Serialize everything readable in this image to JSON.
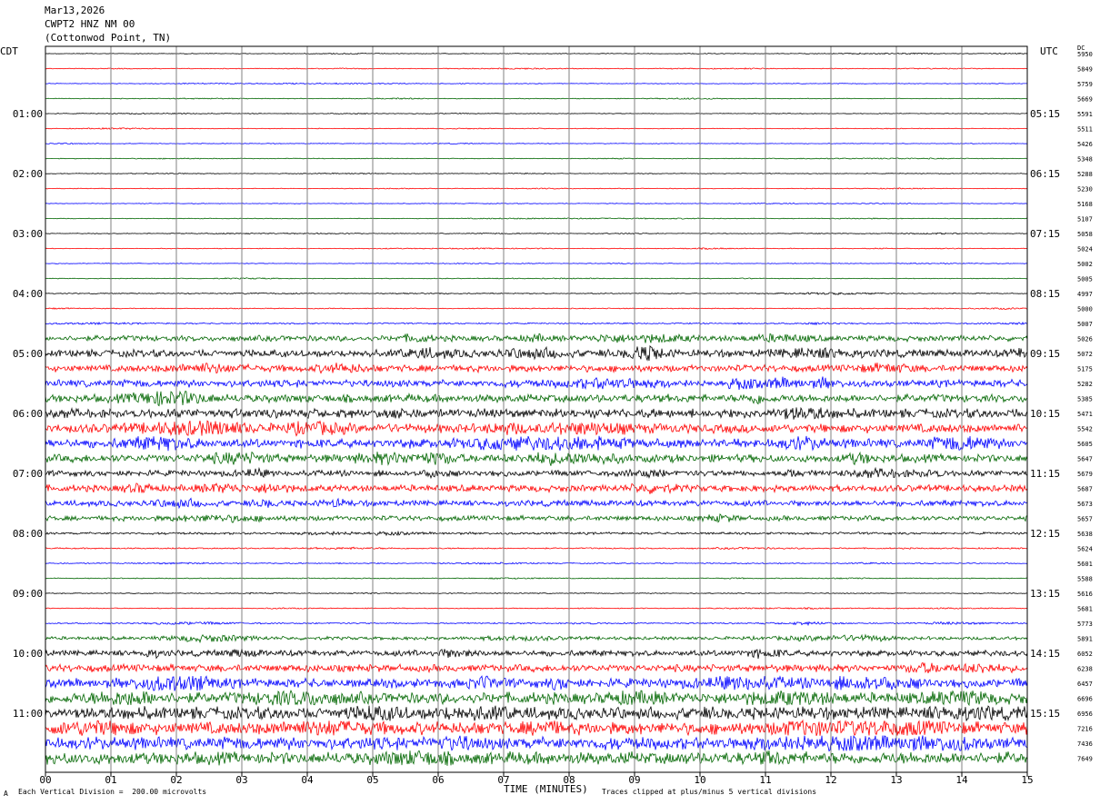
{
  "header": {
    "date": "Mar13,2026",
    "station": "CWPT2 HNZ NM 00",
    "location": "(Cottonwod Point, TN)"
  },
  "left_zone": "CDT",
  "right_zone": "UTC",
  "dc_label": "DC",
  "footer": {
    "scale_note": "Each Vertical Division =  200.00 microvolts",
    "clip_note": "Traces clipped at plus/minus 5 vertical divisions",
    "x_title": "TIME (MINUTES)",
    "mark": "A"
  },
  "chart_data": {
    "type": "line",
    "title": "",
    "xlabel": "TIME (MINUTES)",
    "x_ticks": [
      "00",
      "01",
      "02",
      "03",
      "04",
      "05",
      "06",
      "07",
      "08",
      "09",
      "10",
      "11",
      "12",
      "13",
      "14",
      "15"
    ],
    "xlim": [
      0,
      15
    ],
    "grid": true,
    "trace_colors": [
      "#000000",
      "#ff0000",
      "#0000ff",
      "#006600"
    ],
    "left_hour_labels": [
      "01:00",
      "02:00",
      "03:00",
      "04:00",
      "05:00",
      "06:00",
      "07:00",
      "08:00",
      "09:00",
      "10:00",
      "11:00"
    ],
    "right_hour_labels": [
      "05:15",
      "06:15",
      "07:15",
      "08:15",
      "09:15",
      "10:15",
      "11:15",
      "12:15",
      "13:15",
      "14:15",
      "15:15"
    ],
    "dc_offsets": [
      5950,
      5849,
      5759,
      5669,
      5591,
      5511,
      5426,
      5348,
      5288,
      5230,
      5168,
      5107,
      5058,
      5024,
      5002,
      5005,
      4997,
      5000,
      5007,
      5026,
      5072,
      5175,
      5282,
      5385,
      5471,
      5542,
      5605,
      5647,
      5679,
      5687,
      5673,
      5657,
      5638,
      5624,
      5601,
      5588,
      5616,
      5681,
      5773,
      5891,
      6052,
      6238,
      6457,
      6696,
      6956,
      7216,
      7436,
      7649
    ],
    "activity": [
      0.3,
      0.3,
      0.3,
      0.3,
      0.3,
      0.3,
      0.3,
      0.3,
      0.3,
      0.3,
      0.3,
      0.3,
      0.3,
      0.3,
      0.3,
      0.3,
      0.4,
      0.4,
      0.6,
      2.5,
      3.2,
      3.0,
      3.2,
      3.5,
      4.0,
      4.0,
      4.0,
      3.5,
      2.6,
      3.0,
      2.6,
      2.2,
      1.0,
      0.6,
      0.5,
      0.4,
      0.4,
      0.4,
      0.6,
      1.5,
      2.6,
      3.2,
      4.0,
      5.0,
      5.5,
      5.5,
      5.5,
      5.5
    ],
    "clip_divisions": 5,
    "microvolts_per_division": 200.0
  }
}
